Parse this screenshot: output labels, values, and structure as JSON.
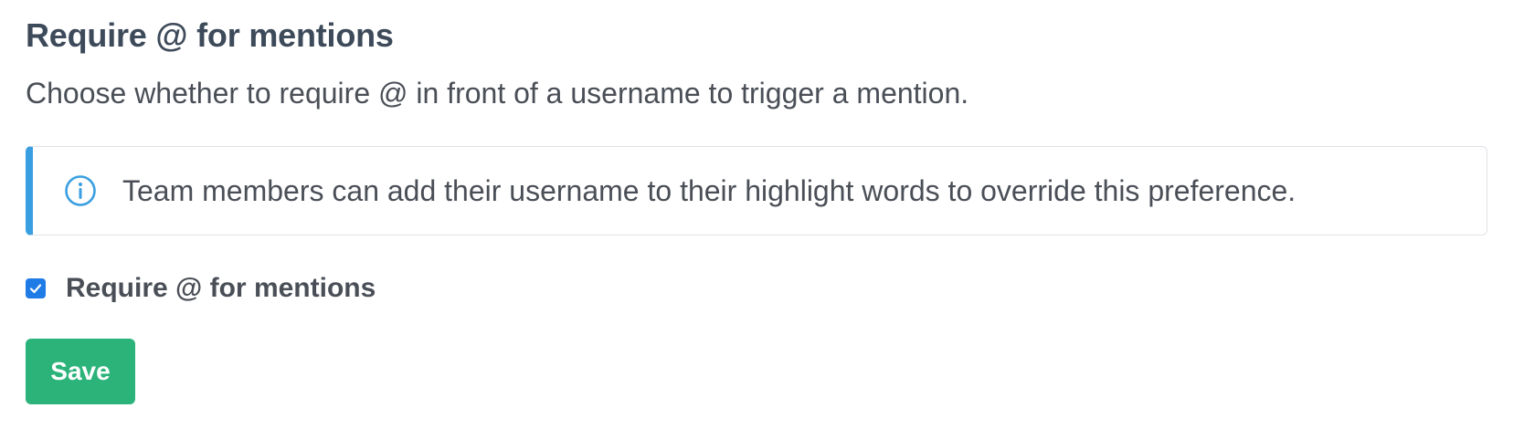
{
  "section": {
    "title": "Require @ for mentions",
    "description": "Choose whether to require @ in front of a username to trigger a mention."
  },
  "banner": {
    "icon": "info-circle-icon",
    "accent_color": "#3a9fe0",
    "message": "Team members can add their username to their highlight words to override this preference."
  },
  "option": {
    "label": "Require @ for mentions",
    "checked": true,
    "checkbox_color": "#1f7be6"
  },
  "actions": {
    "save_label": "Save",
    "save_color": "#2bb37a"
  }
}
